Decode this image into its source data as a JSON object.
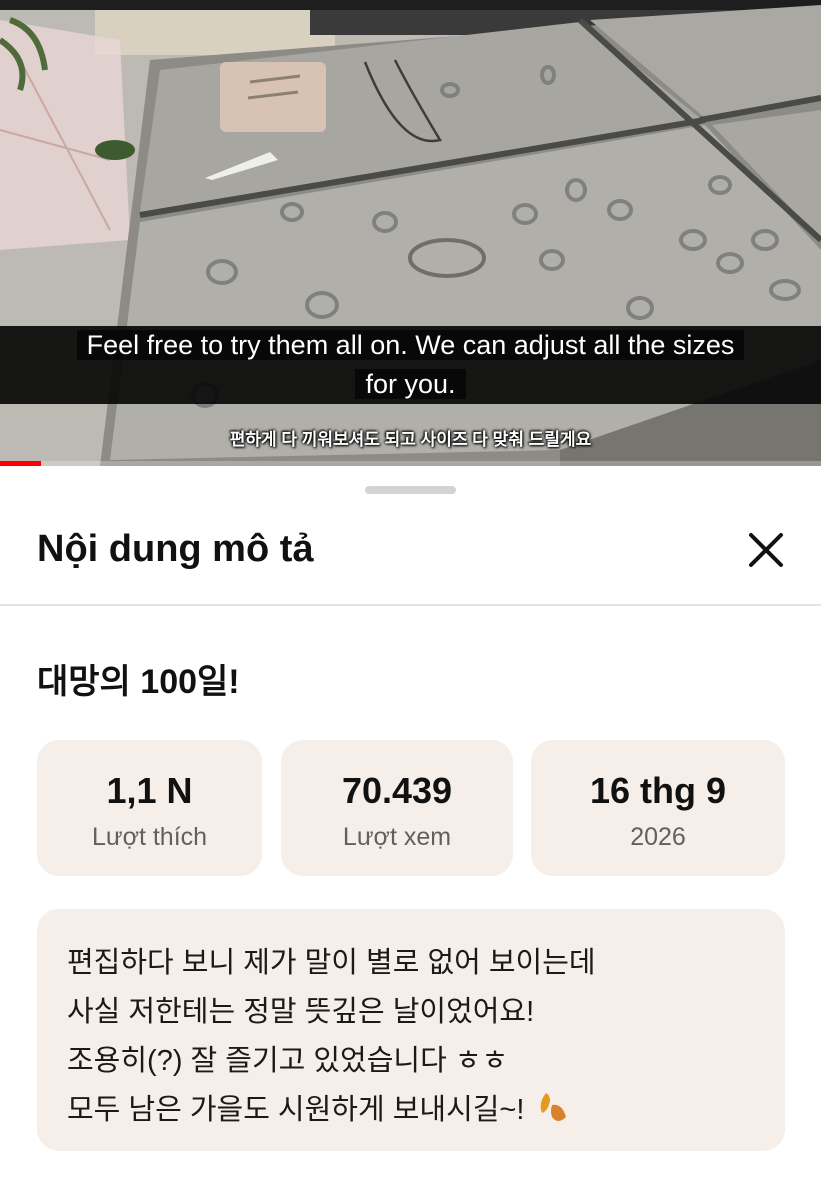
{
  "video": {
    "caption_lines": [
      "Feel free to try them all on. We can adjust all the sizes",
      "for you."
    ],
    "burned_subtitle": "편하게 다 끼워보셔도 되고 사이즈 다 맞춰 드릴게요",
    "progress_fraction": 0.05,
    "progress_color": "#ff0000"
  },
  "sheet": {
    "title": "Nội dung mô tả",
    "close_icon": "close-icon",
    "video_title": "대망의 100일!",
    "stats": [
      {
        "value": "1,1 N",
        "label": "Lượt thích"
      },
      {
        "value": "70.439",
        "label": "Lượt xem"
      },
      {
        "value": "16 thg 9",
        "label": "2026"
      }
    ],
    "description_lines": [
      "편집하다 보니 제가 말이 별로 없어 보이는데",
      "사실 저한테는 정말 뜻깊은 날이었어요!",
      "조용히(?) 잘 즐기고 있었습니다 ㅎㅎ",
      "모두 남은 가을도 시원하게 보내시길~!"
    ],
    "description_icon": "fallen-leaf-icon",
    "colors": {
      "card_bg": "#f6efe9",
      "text": "#111111",
      "muted": "#606060"
    }
  }
}
